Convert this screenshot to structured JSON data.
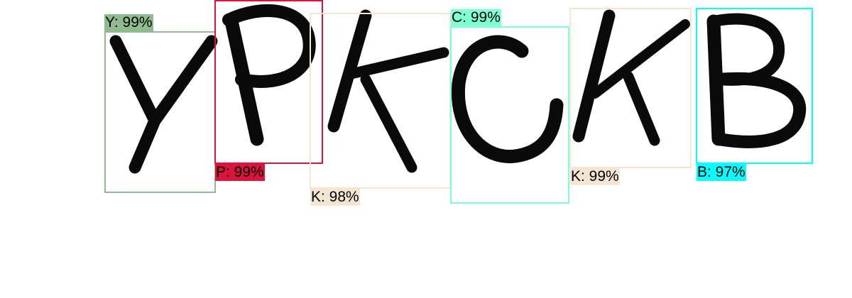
{
  "detections": [
    {
      "label": "Y: 99%",
      "char": "Y",
      "score_percent": 99,
      "color": "#8fbc8f"
    },
    {
      "label": "P: 99%",
      "char": "P",
      "score_percent": 99,
      "color": "#dc143c"
    },
    {
      "label": "K: 98%",
      "char": "K",
      "score_percent": 98,
      "color": "#f5e6d3"
    },
    {
      "label": "C: 99%",
      "char": "C",
      "score_percent": 99,
      "color": "#7fffd4"
    },
    {
      "label": "K: 99%",
      "char": "K",
      "score_percent": 99,
      "color": "#f5e6d3"
    },
    {
      "label": "B: 97%",
      "char": "B",
      "score_percent": 97,
      "color": "#00ffff"
    }
  ]
}
